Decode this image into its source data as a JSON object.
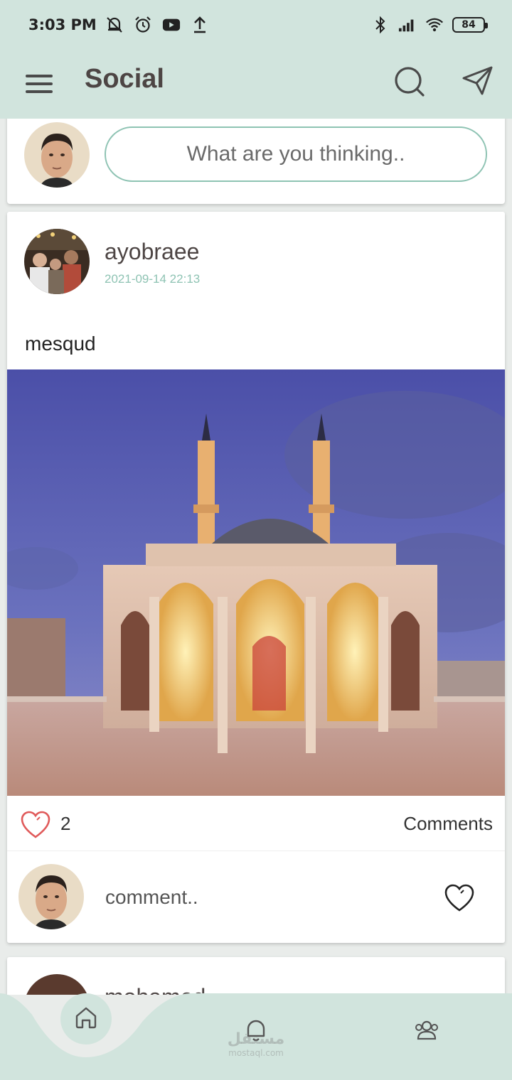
{
  "status_bar": {
    "time": "3:03 PM",
    "battery": "84",
    "icons_left": [
      "mute-bell-icon",
      "alarm-icon",
      "youtube-icon",
      "upload-icon"
    ],
    "icons_right": [
      "bluetooth-icon",
      "signal-icon",
      "wifi-icon",
      "battery-icon"
    ]
  },
  "app_bar": {
    "title": "Social",
    "icons": [
      "menu-icon",
      "search-icon",
      "send-icon"
    ]
  },
  "composer": {
    "placeholder": "What are you thinking.."
  },
  "post": {
    "username": "ayobraee",
    "date": "2021-09-14 22:13",
    "text": "mesqud",
    "like_count": "2",
    "comments_label": "Comments",
    "comment_placeholder": "comment.."
  },
  "next_post": {
    "username": "mohamed"
  },
  "bottom_nav": {
    "items": [
      "home-icon",
      "notification-icon",
      "friends-icon"
    ],
    "watermark_ar": "مستقل",
    "watermark_en": "mostaql.com"
  },
  "colors": {
    "header_bg": "#d1e4dd",
    "accent": "#8ec3b3",
    "title": "#4d4544",
    "like_red": "#e05a5a"
  }
}
